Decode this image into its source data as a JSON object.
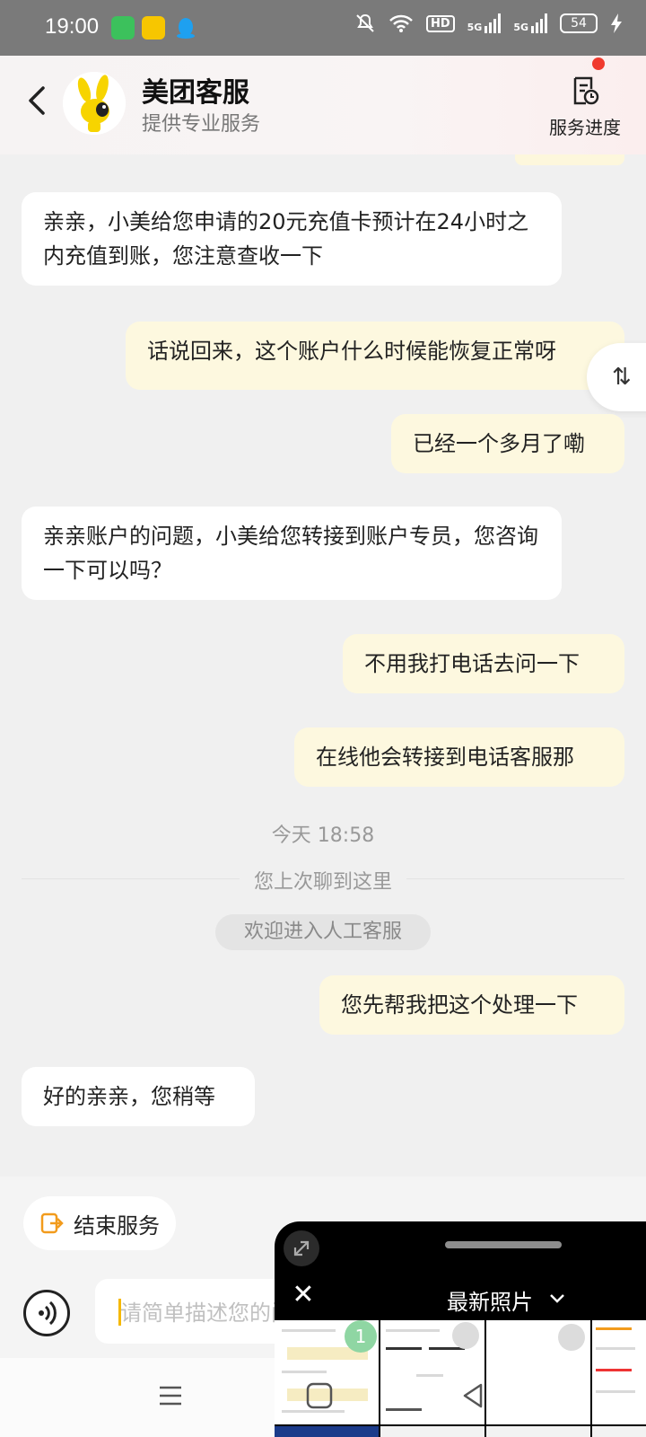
{
  "status_bar": {
    "time": "19:00",
    "network": "5G",
    "network2": "5G",
    "hd": "HD",
    "battery": "54"
  },
  "header": {
    "title": "美团客服",
    "subtitle": "提供专业服务",
    "progress_label": "服务进度"
  },
  "messages": [
    {
      "side": "bot",
      "text": "亲亲，小美给您申请的20元充值卡预计在24小时之内充值到账，您注意查收一下"
    },
    {
      "side": "user",
      "text": "话说回来，这个账户什么时候能恢复正常呀"
    },
    {
      "side": "user",
      "text": "已经一个多月了嘞"
    },
    {
      "side": "bot",
      "text": "亲亲账户的问题，小美给您转接到账户专员，您咨询一下可以吗？"
    },
    {
      "side": "user",
      "text": "不用我打电话去问一下"
    },
    {
      "side": "user",
      "text": "在线他会转接到电话客服那"
    },
    {
      "side": "user",
      "text": "您先帮我把这个处理一下"
    },
    {
      "side": "bot",
      "text": "好的亲亲，您稍等"
    }
  ],
  "timestamp": "今天 18:58",
  "divider_text": "您上次聊到这里",
  "system_notice": "欢迎进入人工客服",
  "scroll_icon": "⇅",
  "bottom": {
    "end_service_label": "结束服务",
    "input_placeholder": "请简单描述您的问题"
  },
  "photo_picker": {
    "title": "最新照片",
    "close": "✕",
    "selected_count": "1"
  },
  "colors": {
    "user_bubble": "#fdf8df",
    "bot_bubble": "#ffffff",
    "accent_orange": "#f29b1c",
    "notify_red": "#f03a2e"
  }
}
